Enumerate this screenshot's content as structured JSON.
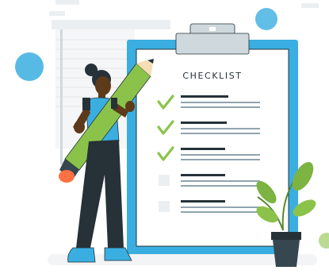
{
  "checklist": {
    "title": "CHECKLIST",
    "items_checked": [
      true,
      true,
      true,
      false,
      false
    ]
  },
  "colors": {
    "accent": "#3aaee0",
    "pencil": "#8bc34a",
    "plant": "#7cb342",
    "dark": "#263238",
    "check": "#8bc34a",
    "line": "#263238",
    "bg_shape": "#eef1f3"
  },
  "icons": [
    "pencil-icon",
    "check-icon",
    "plant-icon",
    "clipboard-clip-icon"
  ]
}
